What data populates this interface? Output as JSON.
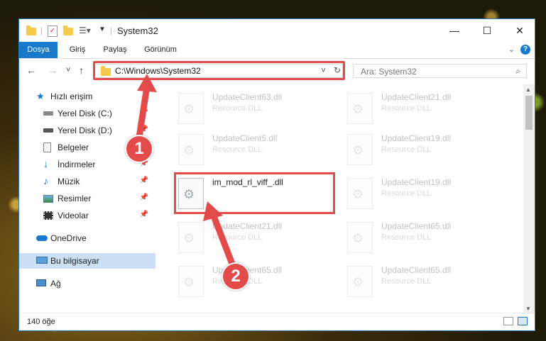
{
  "window": {
    "title": "System32",
    "controls": {
      "minimize": "—",
      "maximize": "☐",
      "close": "✕"
    }
  },
  "ribbon": {
    "tabs": [
      {
        "label": "Dosya",
        "active": true
      },
      {
        "label": "Giriş"
      },
      {
        "label": "Paylaş"
      },
      {
        "label": "Görünüm"
      }
    ],
    "expand_icon": "chevron-down-icon",
    "help": "?"
  },
  "navigation": {
    "back": "←",
    "forward": "→",
    "recent": "˅",
    "up": "↑",
    "address": "C:\\Windows\\System32",
    "address_dropdown": "˅",
    "refresh": "↻",
    "search_placeholder": "Ara: System32",
    "search_icon": "⌕"
  },
  "sidebar": {
    "items": [
      {
        "label": "Hızlı erişim",
        "icon": "star-icon",
        "pinned": false
      },
      {
        "label": "Yerel Disk (C:)",
        "icon": "drive-icon",
        "pinned": true
      },
      {
        "label": "Yerel Disk (D:)",
        "icon": "drive-icon",
        "pinned": true
      },
      {
        "label": "Belgeler",
        "icon": "documents-icon",
        "pinned": true
      },
      {
        "label": "İndirmeler",
        "icon": "download-icon",
        "pinned": true
      },
      {
        "label": "Müzik",
        "icon": "music-icon",
        "pinned": true
      },
      {
        "label": "Resimler",
        "icon": "pictures-icon",
        "pinned": true
      },
      {
        "label": "Videolar",
        "icon": "video-icon",
        "pinned": true
      },
      {
        "label": "OneDrive",
        "icon": "cloud-icon",
        "pinned": false
      },
      {
        "label": "Bu bilgisayar",
        "icon": "computer-icon",
        "pinned": false,
        "selected": true
      },
      {
        "label": "Ağ",
        "icon": "network-icon",
        "pinned": false
      }
    ],
    "pin_glyph": "📌"
  },
  "files": [
    {
      "name": "UpdateClient63.dll",
      "type": "Resource DLL"
    },
    {
      "name": "UpdateClient21.dll",
      "type": "Resource DLL"
    },
    {
      "name": "UpdateClient5.dll",
      "type": "Resource DLL"
    },
    {
      "name": "UpdateClient19.dll",
      "type": "Resource DLL"
    },
    {
      "name": "im_mod_rl_viff_.dll",
      "type": ""
    },
    {
      "name": "UpdateClient19.dll",
      "type": "Resource DLL"
    },
    {
      "name": "UpdateClient21.dll",
      "type": "Resource DLL"
    },
    {
      "name": "UpdateClient65.dll",
      "type": "Resource DLL"
    },
    {
      "name": "UpdateClient65.dll",
      "type": "Resource DLL"
    },
    {
      "name": "UpdateClient65.dll",
      "type": "Resource DLL"
    }
  ],
  "status": {
    "item_count": "140 öğe"
  },
  "annotations": {
    "step1": "1",
    "step2": "2"
  },
  "colors": {
    "accent": "#1979ca",
    "highlight": "#e34b4b"
  }
}
